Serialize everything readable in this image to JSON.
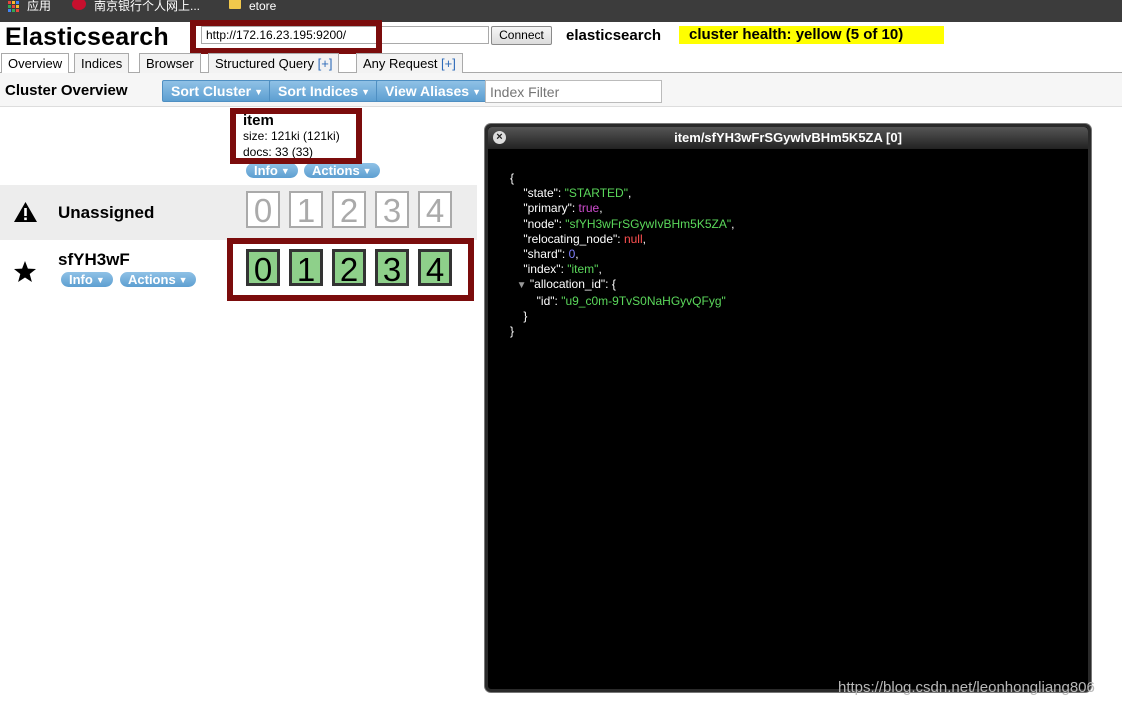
{
  "bookmarks": {
    "apps_label": "应用",
    "bank_label": "南京银行个人网上...",
    "folder_label": "etore",
    "apps_grid_colors": [
      "#e8453c",
      "#f9bb2d",
      "#4285f4",
      "#34a853",
      "#e8453c",
      "#f9bb2d",
      "#4285f4",
      "#34a853",
      "#e8453c"
    ]
  },
  "header": {
    "app_title": "Elasticsearch",
    "url_value": "http://172.16.23.195:9200/",
    "connect_label": "Connect",
    "cluster_name": "elasticsearch",
    "cluster_health": "cluster health: yellow (5 of 10)",
    "health_color": "#ffff00"
  },
  "tabs": [
    {
      "label": "Overview",
      "plus": ""
    },
    {
      "label": "Indices",
      "plus": ""
    },
    {
      "label": "Browser",
      "plus": ""
    },
    {
      "label": "Structured Query ",
      "plus": "[+]"
    },
    {
      "label": "Any Request ",
      "plus": "[+]"
    }
  ],
  "toolbar": {
    "title": "Cluster Overview",
    "sort_cluster": "Sort Cluster",
    "sort_indices": "Sort Indices",
    "view_aliases": "View Aliases",
    "index_filter_placeholder": "Index Filter"
  },
  "index": {
    "name": "item",
    "size": "size: 121ki (121ki)",
    "docs": "docs: 33 (33)",
    "info_label": "Info",
    "actions_label": "Actions"
  },
  "rows": {
    "unassigned": {
      "label": "Unassigned",
      "icon": "warning-icon",
      "shards": [
        "0",
        "1",
        "2",
        "3",
        "4"
      ]
    },
    "node": {
      "label": "sfYH3wF",
      "icon": "star-icon",
      "info_label": "Info",
      "actions_label": "Actions",
      "shards": [
        "0",
        "1",
        "2",
        "3",
        "4"
      ],
      "shard_color": "#8ed08a"
    }
  },
  "dialog": {
    "title": "item/sfYH3wFrSGywIvBHm5K5ZA [0]",
    "json": {
      "open": "{",
      "state_key": "\"state\"",
      "state_val": "\"STARTED\"",
      "primary_key": "\"primary\"",
      "primary_val": "true",
      "node_key": "\"node\"",
      "node_val": "\"sfYH3wFrSGywIvBHm5K5ZA\"",
      "relocating_key": "\"relocating_node\"",
      "relocating_val": "null",
      "shard_key": "\"shard\"",
      "shard_val": "0",
      "index_key": "\"index\"",
      "index_val": "\"item\"",
      "alloc_key": "\"allocation_id\"",
      "alloc_id_key": "\"id\"",
      "alloc_id_val": "\"u9_c0m-9TvS0NaHGyvQFyg\"",
      "inner_close": "}",
      "close": "}"
    }
  },
  "watermark": "https://blog.csdn.net/leonhongliang806"
}
